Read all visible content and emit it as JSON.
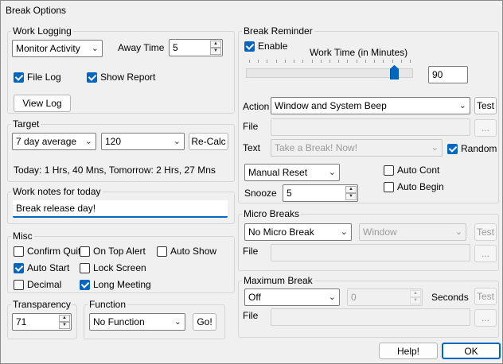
{
  "window": {
    "title": "Break Options"
  },
  "work_logging": {
    "label": "Work Logging",
    "mode": "Monitor Activity",
    "away_time_label": "Away Time",
    "away_time": "5",
    "file_log": {
      "label": "File Log",
      "checked": true
    },
    "show_report": {
      "label": "Show Report",
      "checked": true
    },
    "view_log": "View Log"
  },
  "target": {
    "label": "Target",
    "period": "7 day average",
    "value": "120",
    "recalc": "Re-Calc",
    "summary": "Today: 1 Hrs, 40 Mns, Tomorrow: 2 Hrs, 27 Mns"
  },
  "notes": {
    "label": "Work notes for today",
    "value": "Break release day!"
  },
  "misc": {
    "label": "Misc",
    "confirm_quit": {
      "label": "Confirm Quit",
      "checked": false
    },
    "on_top_alert": {
      "label": "On Top Alert",
      "checked": false
    },
    "auto_show": {
      "label": "Auto Show",
      "checked": false
    },
    "auto_start": {
      "label": "Auto Start",
      "checked": true
    },
    "lock_screen": {
      "label": "Lock Screen",
      "checked": false
    },
    "decimal": {
      "label": "Decimal",
      "checked": false
    },
    "long_meeting": {
      "label": "Long Meeting",
      "checked": true
    }
  },
  "transparency": {
    "label": "Transparency",
    "value": "71"
  },
  "function": {
    "label": "Function",
    "value": "No Function",
    "go": "Go!"
  },
  "break_reminder": {
    "label": "Break Reminder",
    "enable": {
      "label": "Enable",
      "checked": true
    },
    "work_time_label": "Work Time (in Minutes)",
    "work_time": "90",
    "work_time_level": 0.91,
    "action_label": "Action",
    "action": "Window and System Beep",
    "test": "Test",
    "file_label": "File",
    "file_value": "",
    "browse": "...",
    "text_label": "Text",
    "text_value": "Take a Break! Now!",
    "random": {
      "label": "Random",
      "checked": true
    },
    "reset_mode": "Manual Reset",
    "auto_cont": {
      "label": "Auto Cont",
      "checked": false
    },
    "auto_begin": {
      "label": "Auto Begin",
      "checked": false
    },
    "snooze_label": "Snooze",
    "snooze": "5"
  },
  "micro_breaks": {
    "label": "Micro Breaks",
    "mode": "No Micro Break",
    "type": "Window",
    "test": "Test",
    "file_label": "File",
    "browse": "..."
  },
  "maximum_break": {
    "label": "Maximum Break",
    "mode": "Off",
    "value": "0",
    "seconds_label": "Seconds",
    "test": "Test",
    "file_label": "File",
    "browse": "..."
  },
  "footer": {
    "help": "Help!",
    "ok": "OK"
  },
  "colors": {
    "accent": "#0067c0"
  },
  "icons": {
    "dropdown": "chevron-down-icon",
    "check": "checkmark-icon"
  }
}
